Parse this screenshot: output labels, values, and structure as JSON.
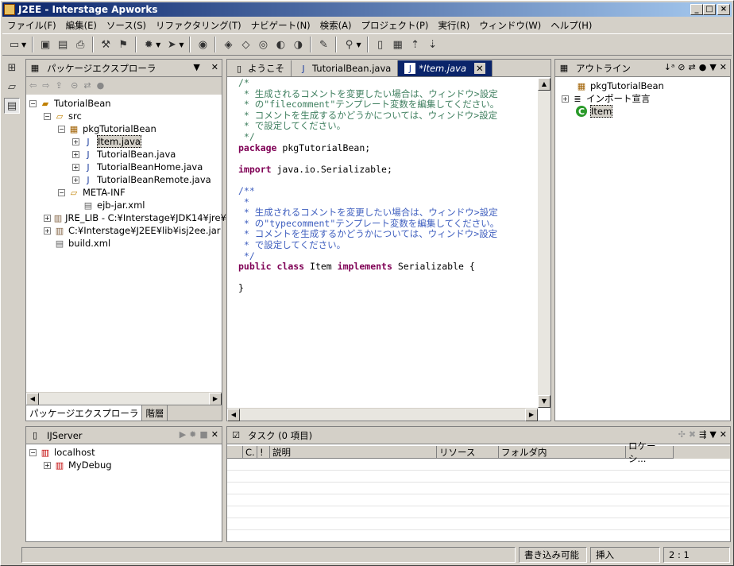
{
  "window": {
    "title": "J2EE - Interstage Apworks"
  },
  "menu": [
    "ファイル(F)",
    "編集(E)",
    "ソース(S)",
    "リファクタリング(T)",
    "ナビゲート(N)",
    "検索(A)",
    "プロジェクト(P)",
    "実行(R)",
    "ウィンドウ(W)",
    "ヘルプ(H)"
  ],
  "package_explorer": {
    "title": "パッケージエクスプローラ",
    "tree": [
      "TutorialBean",
      "src",
      "pkgTutorialBean",
      "Item.java",
      "TutorialBean.java",
      "TutorialBeanHome.java",
      "TutorialBeanRemote.java",
      "META-INF",
      "ejb-jar.xml",
      "JRE_LIB - C:¥Interstage¥JDK14¥jre¥",
      "C:¥Interstage¥J2EE¥lib¥isj2ee.jar",
      "build.xml"
    ],
    "tabs": [
      "パッケージエクスプローラ",
      "階層"
    ]
  },
  "editor": {
    "tabs": [
      "ようこそ",
      "TutorialBean.java",
      "*Item.java"
    ],
    "lines": [
      {
        "t": "/*",
        "c": "cmt"
      },
      {
        "t": " * 生成されるコメントを変更したい場合は、ウィンドウ>設定",
        "c": "cmt"
      },
      {
        "t": " * の\"filecomment\"テンプレート変数を編集してください。",
        "c": "cmt"
      },
      {
        "t": " * コメントを生成するかどうかについては、ウィンドウ>設定",
        "c": "cmt"
      },
      {
        "t": " * で設定してください。",
        "c": "cmt"
      },
      {
        "t": " */",
        "c": "cmt"
      },
      {
        "k": "package",
        "t": " pkgTutorialBean;"
      },
      {
        "t": ""
      },
      {
        "k": "import",
        "t": " java.io.Serializable;"
      },
      {
        "t": ""
      },
      {
        "t": "/**",
        "c": "jd"
      },
      {
        "t": " *",
        "c": "jd"
      },
      {
        "t": " * 生成されるコメントを変更したい場合は、ウィンドウ>設定",
        "c": "jd"
      },
      {
        "t": " * の\"typecomment\"テンプレート変数を編集してください。",
        "c": "jd"
      },
      {
        "t": " * コメントを生成するかどうかについては、ウィンドウ>設定",
        "c": "jd"
      },
      {
        "t": " * で設定してください。",
        "c": "jd"
      },
      {
        "t": " */",
        "c": "jd"
      },
      {
        "cls": true
      },
      {
        "t": ""
      },
      {
        "t": "}"
      }
    ],
    "class_line": {
      "k1": "public",
      "k2": "class",
      "name": " Item ",
      "k3": "implements",
      "rest": " Serializable {"
    }
  },
  "outline": {
    "title": "アウトライン",
    "items": [
      "pkgTutorialBean",
      "インポート宣言",
      "Item"
    ]
  },
  "server": {
    "title": "IJServer",
    "items": [
      "localhost",
      "MyDebug"
    ]
  },
  "tasks": {
    "title": "タスク (0 項目)",
    "columns": [
      "C.",
      "!",
      "説明",
      "リソース",
      "フォルダ内",
      "ロケーシ..."
    ]
  },
  "status": {
    "writable": "書き込み可能",
    "mode": "挿入",
    "position": "2 : 1"
  }
}
